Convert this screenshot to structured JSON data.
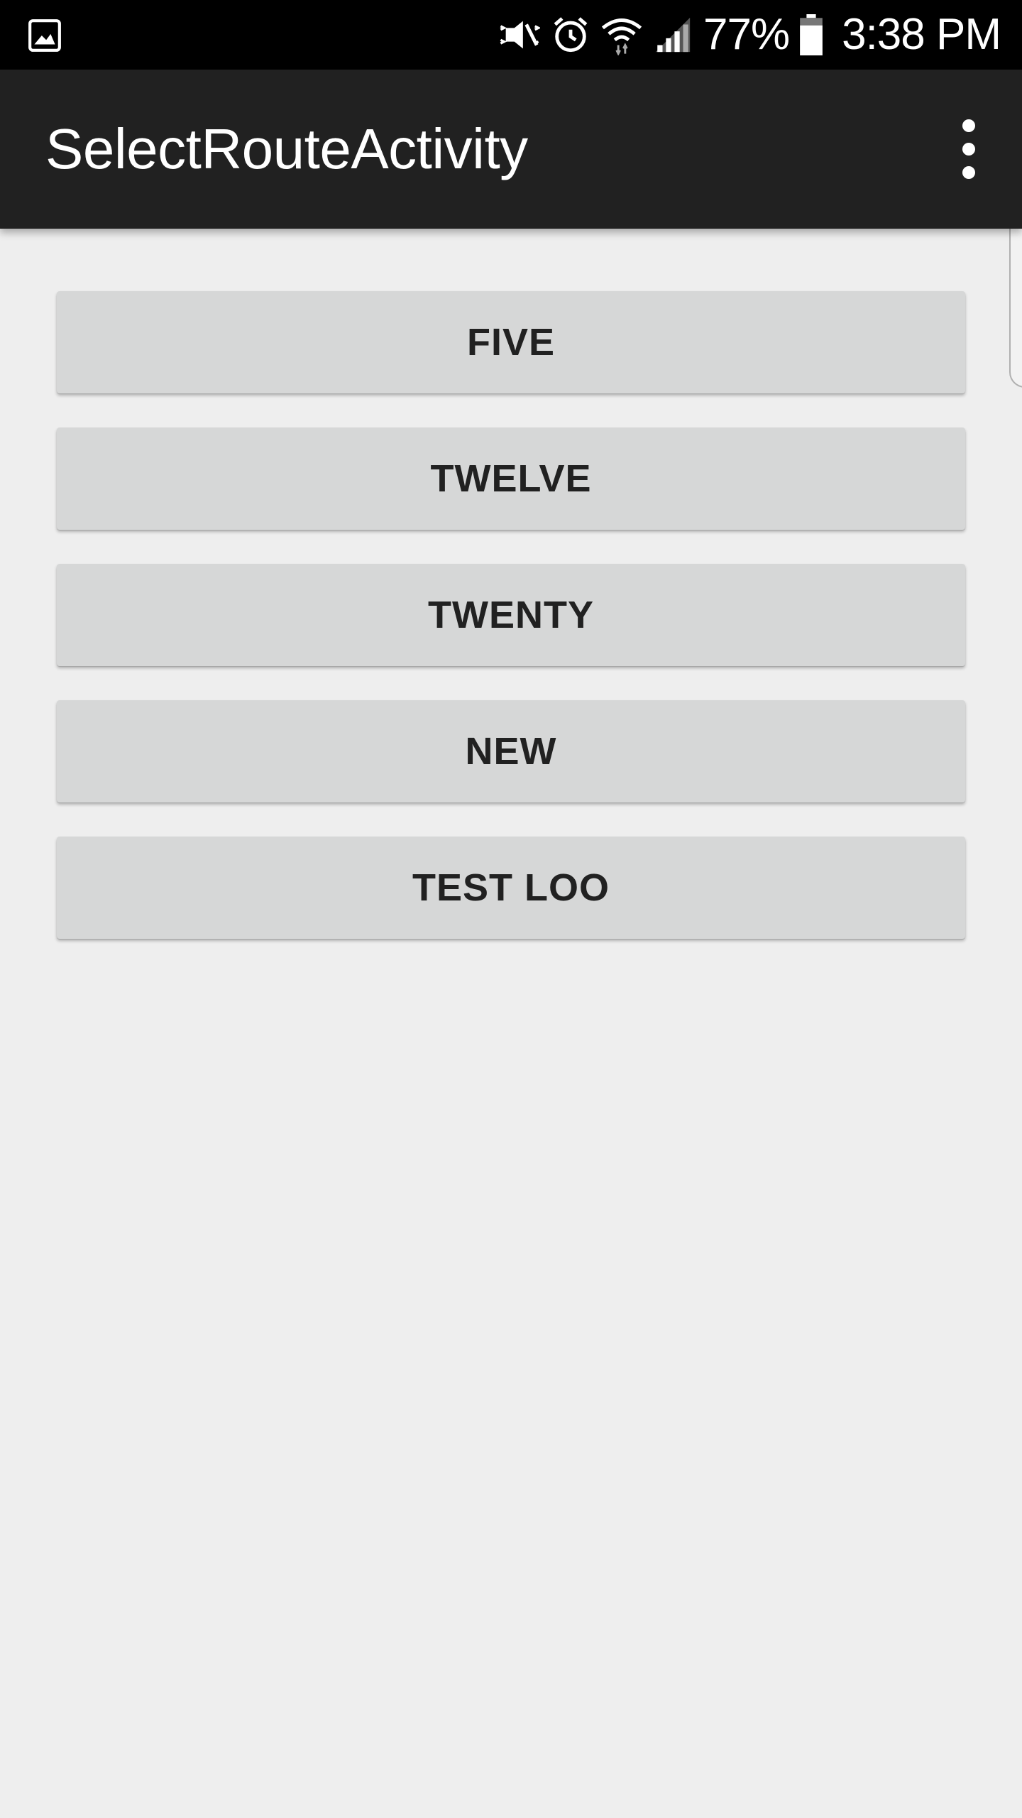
{
  "status_bar": {
    "battery_percent": "77%",
    "time": "3:38 PM",
    "icons": [
      "gallery-icon",
      "vibrate-mute-icon",
      "alarm-icon",
      "wifi-icon",
      "signal-icon",
      "battery-icon"
    ]
  },
  "action_bar": {
    "title": "SelectRouteActivity",
    "overflow_icon": "more-vert-icon"
  },
  "routes": [
    {
      "label": "FIVE"
    },
    {
      "label": "TWELVE"
    },
    {
      "label": "TWENTY"
    },
    {
      "label": "NEW"
    },
    {
      "label": "TEST LOO"
    }
  ],
  "colors": {
    "status_bar": "#000000",
    "action_bar": "#212121",
    "background": "#eeeeee",
    "button": "#d6d7d7",
    "button_text": "#212121"
  }
}
